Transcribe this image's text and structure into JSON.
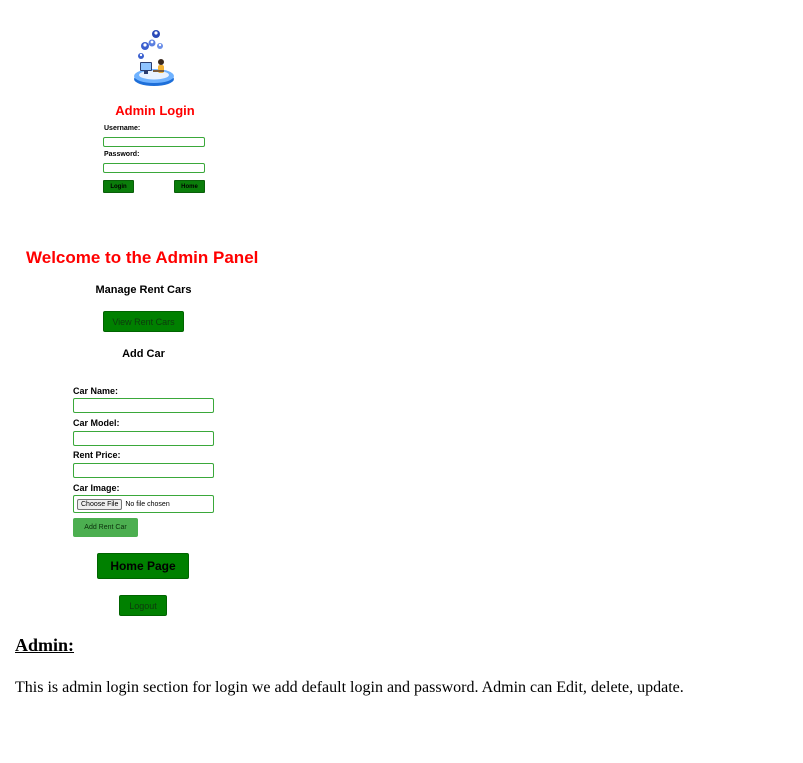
{
  "login": {
    "logo_icon": "admin-computer-illustration",
    "title": "Admin Login",
    "username_label": "Username:",
    "username_value": "",
    "password_label": "Password:",
    "password_value": "",
    "login_button": "Login",
    "home_button": "Home"
  },
  "panel": {
    "title": "Welcome to the Admin Panel",
    "manage_heading": "Manage Rent Cars",
    "view_button": "View Rent Cars",
    "add_heading": "Add Car",
    "car_name_label": "Car Name:",
    "car_model_label": "Car Model:",
    "rent_price_label": "Rent Price:",
    "car_image_label": "Car Image:",
    "choose_file_button": "Choose File",
    "file_status": "No file chosen",
    "add_button": "Add Rent Car",
    "home_page_button": "Home Page",
    "logout_button": "Logout"
  },
  "description": {
    "heading": "Admin:",
    "text": "This is admin login section for login we add default login and password. Admin can Edit, delete, update."
  },
  "colors": {
    "title_red": "#ff0000",
    "button_green": "#008000",
    "add_button_green": "#4caf50",
    "input_border": "#3aa83a"
  }
}
